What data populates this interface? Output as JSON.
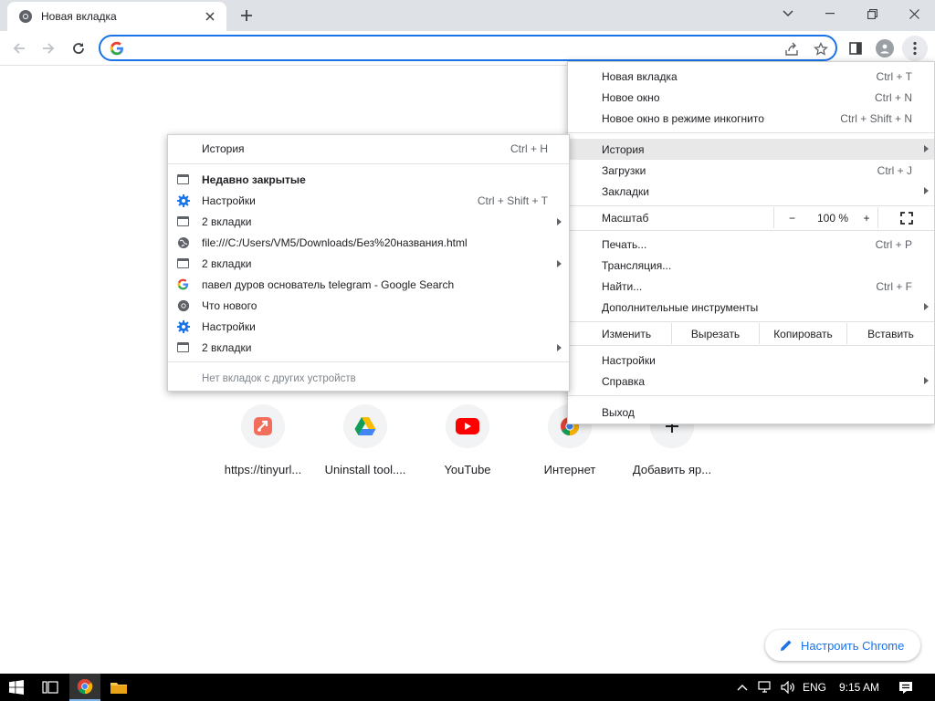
{
  "tab": {
    "title": "Новая вкладка"
  },
  "omnibox": {
    "value": "",
    "placeholder": ""
  },
  "shortcuts": [
    {
      "label": "https://tinyurl...",
      "icon": "tinyurl-icon"
    },
    {
      "label": "Uninstall tool....",
      "icon": "google-drive-icon"
    },
    {
      "label": "YouTube",
      "icon": "youtube-icon"
    },
    {
      "label": "Интернет",
      "icon": "chrome-icon"
    },
    {
      "label": "Добавить яр...",
      "icon": "plus-icon"
    }
  ],
  "customize": {
    "label": "Настроить Chrome"
  },
  "menu": {
    "new_tab": {
      "label": "Новая вкладка",
      "shortcut": "Ctrl + T"
    },
    "new_window": {
      "label": "Новое окно",
      "shortcut": "Ctrl + N"
    },
    "incognito": {
      "label": "Новое окно в режиме инкогнито",
      "shortcut": "Ctrl + Shift + N"
    },
    "history": {
      "label": "История"
    },
    "downloads": {
      "label": "Загрузки",
      "shortcut": "Ctrl + J"
    },
    "bookmarks": {
      "label": "Закладки"
    },
    "zoom": {
      "label": "Масштаб",
      "minus": "−",
      "value": "100 %",
      "plus": "+"
    },
    "print": {
      "label": "Печать...",
      "shortcut": "Ctrl + P"
    },
    "cast": {
      "label": "Трансляция..."
    },
    "find": {
      "label": "Найти...",
      "shortcut": "Ctrl + F"
    },
    "more_tools": {
      "label": "Дополнительные инструменты"
    },
    "edit": {
      "label": "Изменить",
      "cut": "Вырезать",
      "copy": "Копировать",
      "paste": "Вставить"
    },
    "settings": {
      "label": "Настройки"
    },
    "help": {
      "label": "Справка"
    },
    "exit": {
      "label": "Выход"
    }
  },
  "history_submenu": {
    "history": {
      "label": "История",
      "shortcut": "Ctrl + H"
    },
    "recently_closed": {
      "label": "Недавно закрытые"
    },
    "items": [
      {
        "label": "Настройки",
        "shortcut": "Ctrl + Shift + T",
        "icon": "settings-gear-icon",
        "arrow": false
      },
      {
        "label": "2 вкладки",
        "shortcut": "",
        "icon": "tab-window-icon",
        "arrow": true
      },
      {
        "label": "file:///C:/Users/VM5/Downloads/Без%20названия.html",
        "shortcut": "",
        "icon": "globe-icon",
        "arrow": false
      },
      {
        "label": "2 вкладки",
        "shortcut": "",
        "icon": "tab-window-icon",
        "arrow": true
      },
      {
        "label": "павел дуров основатель telegram - Google Search",
        "shortcut": "",
        "icon": "google-g-icon",
        "arrow": false
      },
      {
        "label": "Что нового",
        "shortcut": "",
        "icon": "chrome-icon",
        "arrow": false
      },
      {
        "label": "Настройки",
        "shortcut": "",
        "icon": "settings-gear-icon",
        "arrow": false
      },
      {
        "label": "2 вкладки",
        "shortcut": "",
        "icon": "tab-window-icon",
        "arrow": true
      }
    ],
    "no_tabs": {
      "label": "Нет вкладок с других устройств"
    }
  },
  "taskbar": {
    "lang": "ENG",
    "time": "9:15 AM"
  },
  "colors": {
    "accent": "#1a73e8",
    "menu_highlight": "#e8e8e8",
    "tabstrip": "#dee1e6"
  }
}
